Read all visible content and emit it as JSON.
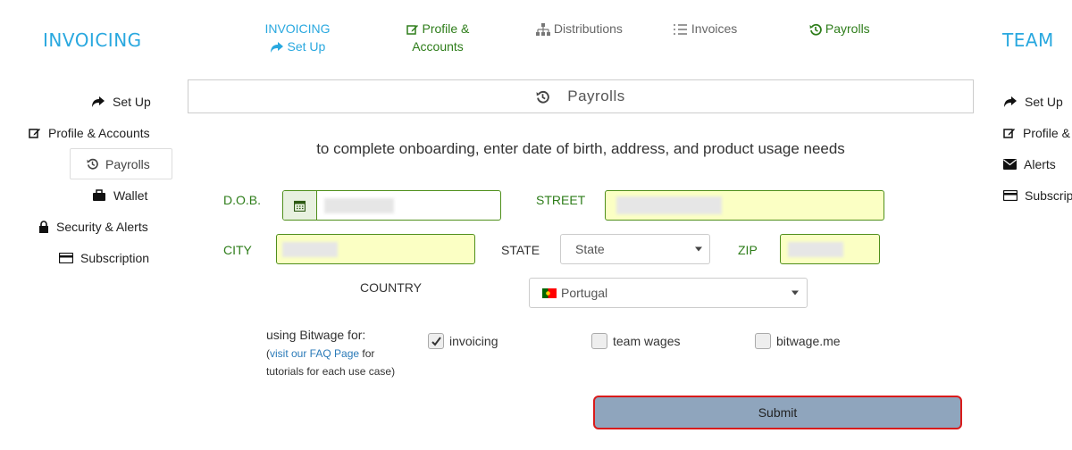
{
  "brand_left": "INVOICING",
  "brand_right": "TEAM",
  "topnav": {
    "invoicing_setup": {
      "line1": "INVOICING",
      "line2": "Set Up"
    },
    "profile": {
      "line1": "Profile &",
      "line2": "Accounts"
    },
    "distributions": "Distributions",
    "invoices": "Invoices",
    "payrolls": "Payrolls"
  },
  "left_menu": {
    "setup": "Set Up",
    "profile": "Profile & Accounts",
    "payrolls": "Payrolls",
    "wallet": "Wallet",
    "security": "Security & Alerts",
    "subscription": "Subscription"
  },
  "right_menu": {
    "setup": "Set Up",
    "profile": "Profile &",
    "alerts": "Alerts",
    "subscription": "Subscript"
  },
  "header": {
    "title": "Payrolls"
  },
  "instruction": "to complete onboarding, enter date of birth, address, and product usage needs",
  "form": {
    "dob_label": "D.O.B.",
    "street_label": "STREET",
    "city_label": "CITY",
    "state_label": "STATE",
    "state_value": "State",
    "zip_label": "ZIP",
    "country_label": "COUNTRY",
    "country_value": "Portugal",
    "usage_label": "using Bitwage for:",
    "usage_note_prefix": "(",
    "usage_note_link": "visit our FAQ Page",
    "usage_note_suffix": " for",
    "usage_note_line2": "tutorials for each use case)",
    "options": [
      {
        "label": "invoicing",
        "checked": true
      },
      {
        "label": "team wages",
        "checked": false
      },
      {
        "label": "bitwage.me",
        "checked": false
      }
    ],
    "submit_label": "Submit"
  },
  "colors": {
    "brand_blue": "#29a8df",
    "nav_green": "#2e7d1a",
    "field_yellow": "#fbffc4",
    "submit_bg": "#8fa5bd",
    "submit_border": "#d91b1b"
  }
}
